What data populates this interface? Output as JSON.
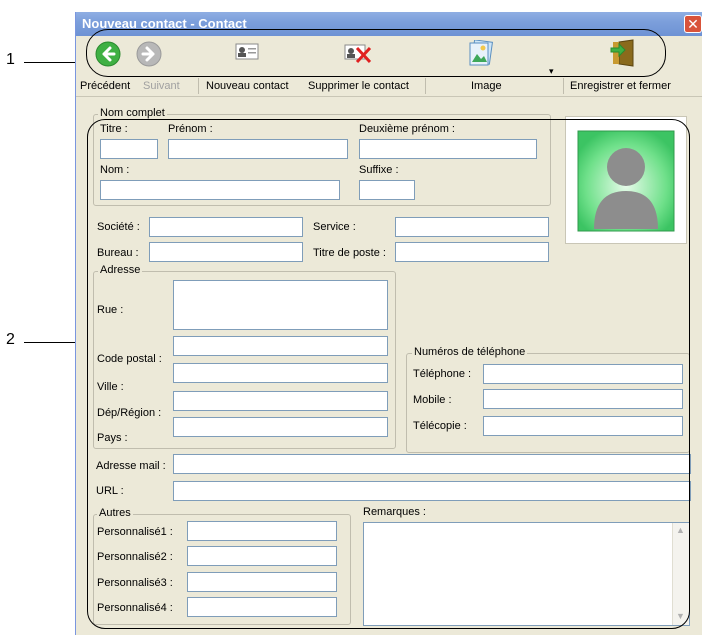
{
  "callouts": {
    "one": "1",
    "two": "2"
  },
  "window": {
    "title": "Nouveau contact - Contact",
    "close_glyph": "✕"
  },
  "toolbar": {
    "back": "Précédent",
    "next": "Suivant",
    "new_contact": "Nouveau contact",
    "delete_contact": "Supprimer le contact",
    "image": "Image",
    "save_close": "Enregistrer et fermer"
  },
  "name_group": {
    "title": "Nom complet",
    "titre": "Titre :",
    "prenom": "Prénom :",
    "deuxieme_prenom": "Deuxième prénom :",
    "nom": "Nom :",
    "suffixe": "Suffixe :"
  },
  "company": {
    "societe": "Société :",
    "service": "Service :",
    "bureau": "Bureau :",
    "titre_poste": "Titre de poste :"
  },
  "address": {
    "title": "Adresse",
    "rue": "Rue :",
    "code_postal": "Code postal :",
    "ville": "Ville :",
    "dep_region": "Dép/Région :",
    "pays": "Pays :"
  },
  "phones": {
    "title": "Numéros de téléphone",
    "telephone": "Téléphone :",
    "mobile": "Mobile :",
    "telecopie": "Télécopie :"
  },
  "contact": {
    "email": "Adresse mail :",
    "url": "URL :"
  },
  "others": {
    "title": "Autres",
    "custom1": "Personnalisé1 :",
    "custom2": "Personnalisé2 :",
    "custom3": "Personnalisé3 :",
    "custom4": "Personnalisé4 :"
  },
  "remarks": {
    "label": "Remarques :"
  },
  "icons": {
    "back": "back-arrow-icon",
    "next": "forward-arrow-icon",
    "new_contact": "contact-card-icon",
    "delete_contact": "delete-contact-icon",
    "image": "picture-icon",
    "save_close": "door-exit-icon",
    "photo": "person-silhouette-icon"
  },
  "colors": {
    "titlebar": "#7c9fdb",
    "window_bg": "#ece9d8",
    "field_border": "#7f9db9",
    "photo_green": "#4ccf72"
  }
}
